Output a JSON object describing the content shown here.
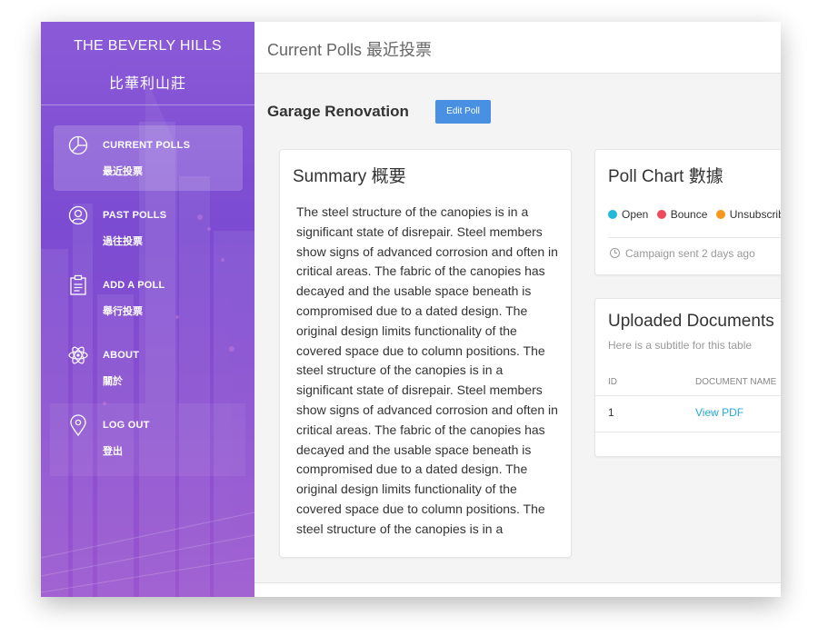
{
  "sidebar": {
    "brand_title": "THE BEVERLY HILLS",
    "brand_subtitle": "比華利山莊",
    "items": [
      {
        "label": "CURRENT POLLS",
        "sub": "最近投票",
        "icon": "pie-chart-icon",
        "active": true
      },
      {
        "label": "PAST POLLS",
        "sub": "過往投票",
        "icon": "user-icon",
        "active": false
      },
      {
        "label": "ADD A POLL",
        "sub": "舉行投票",
        "icon": "clipboard-icon",
        "active": false
      },
      {
        "label": "ABOUT",
        "sub": "關於",
        "icon": "atom-icon",
        "active": false
      },
      {
        "label": "LOG OUT",
        "sub": "登出",
        "icon": "location-pin-icon",
        "active": false
      }
    ]
  },
  "header": {
    "title": "Current Polls 最近投票"
  },
  "poll": {
    "title": "Garage Renovation",
    "edit_label": "Edit Poll"
  },
  "summary": {
    "title": "Summary 概要",
    "body": "The steel structure of the canopies is in a significant state of disrepair. Steel members show signs of advanced corrosion and often in critical areas. The fabric of the canopies has decayed and the usable space beneath is compromised due to a dated design. The original design limits functionality of the covered space due to column positions. The steel structure of the canopies is in a significant state of disrepair. Steel members show signs of advanced corrosion and often in critical areas. The fabric of the canopies has decayed and the usable space beneath is compromised due to a dated design. The original design limits functionality of the covered space due to column positions. The steel structure of the canopies is in a"
  },
  "chart_card": {
    "title": "Poll Chart 數據",
    "legend": [
      {
        "label": "Open",
        "color": "#22b8d8"
      },
      {
        "label": "Bounce",
        "color": "#ef4a5b"
      },
      {
        "label": "Unsubscribe",
        "color": "#f6961e"
      }
    ],
    "footer": "Campaign sent 2 days ago"
  },
  "documents": {
    "title": "Uploaded Documents",
    "subtitle": "Here is a subtitle for this table",
    "columns": [
      "ID",
      "DOCUMENT NAME"
    ],
    "rows": [
      {
        "id": "1",
        "name": "View PDF"
      }
    ]
  },
  "colors": {
    "accent_button": "#4a90e2",
    "link": "#26a8d8",
    "sidebar_purple": "#7b4bd1"
  }
}
